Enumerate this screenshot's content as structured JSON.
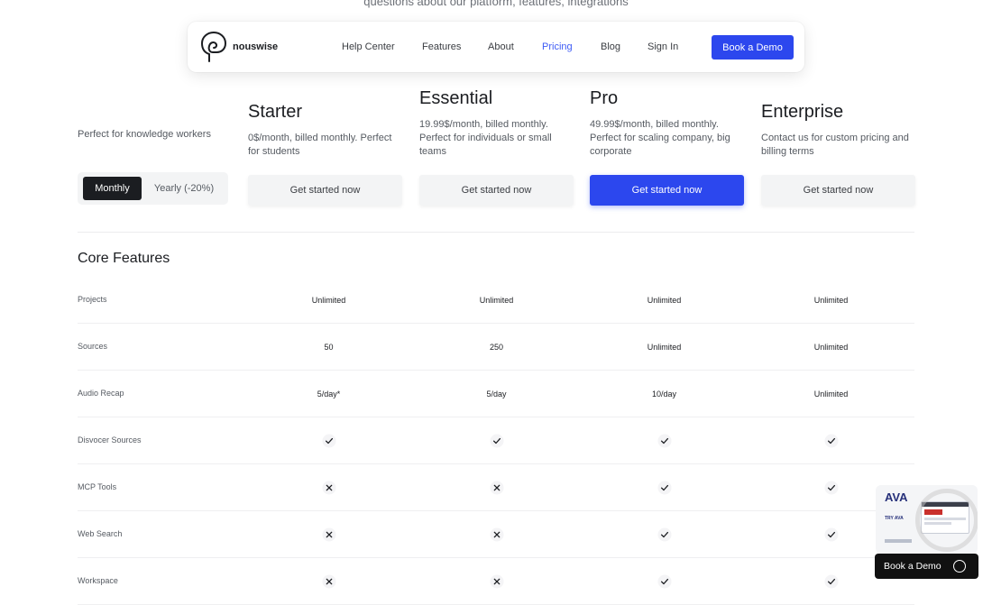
{
  "top_caption": "questions about our platform, features, integrations",
  "nav": {
    "logo_text": "nouswise",
    "links": [
      "Help Center",
      "Features",
      "About",
      "Pricing",
      "Blog",
      "Sign In"
    ],
    "active": "Pricing",
    "cta": "Book a Demo",
    "accent": "#2c47ee"
  },
  "intro_text": "Perfect for knowledge workers",
  "billing_toggle": {
    "selected": "Monthly",
    "other": "Yearly (-20%)"
  },
  "plans": [
    {
      "name": "Starter",
      "description": "0$/month, billed monthly. Perfect for students",
      "cta": "Get started now"
    },
    {
      "name": "Essential",
      "description": "19.99$/month, billed monthly. Perfect for individuals or small teams",
      "cta": "Get started now"
    },
    {
      "name": "Pro",
      "description": "49.99$/month, billed monthly. Perfect for scaling company, big corporate",
      "cta": "Get started now",
      "highlight": true
    },
    {
      "name": "Enterprise",
      "description": "Contact us for custom pricing and billing terms",
      "cta": "Get started now"
    }
  ],
  "section_title": "Core Features",
  "features": [
    {
      "label": "Projects",
      "values": [
        "Unlimited",
        "Unlimited",
        "Unlimited",
        "Unlimited"
      ]
    },
    {
      "label": "Sources",
      "values": [
        "50",
        "250",
        "Unlimited",
        "Unlimited"
      ]
    },
    {
      "label": "Audio Recap",
      "values": [
        "5/day*",
        "5/day",
        "10/day",
        "Unlimited"
      ]
    },
    {
      "label": "Disvocer Sources",
      "values": [
        "check",
        "check",
        "check",
        "check"
      ]
    },
    {
      "label": "MCP Tools",
      "values": [
        "cross",
        "cross",
        "check",
        "check"
      ]
    },
    {
      "label": "Web Search",
      "values": [
        "cross",
        "cross",
        "check",
        "check"
      ]
    },
    {
      "label": "Workspace",
      "values": [
        "cross",
        "cross",
        "check",
        "check"
      ]
    }
  ],
  "promo": {
    "logo": "AVA",
    "tagline": "TRY AVA",
    "cta": "Book a Demo"
  }
}
